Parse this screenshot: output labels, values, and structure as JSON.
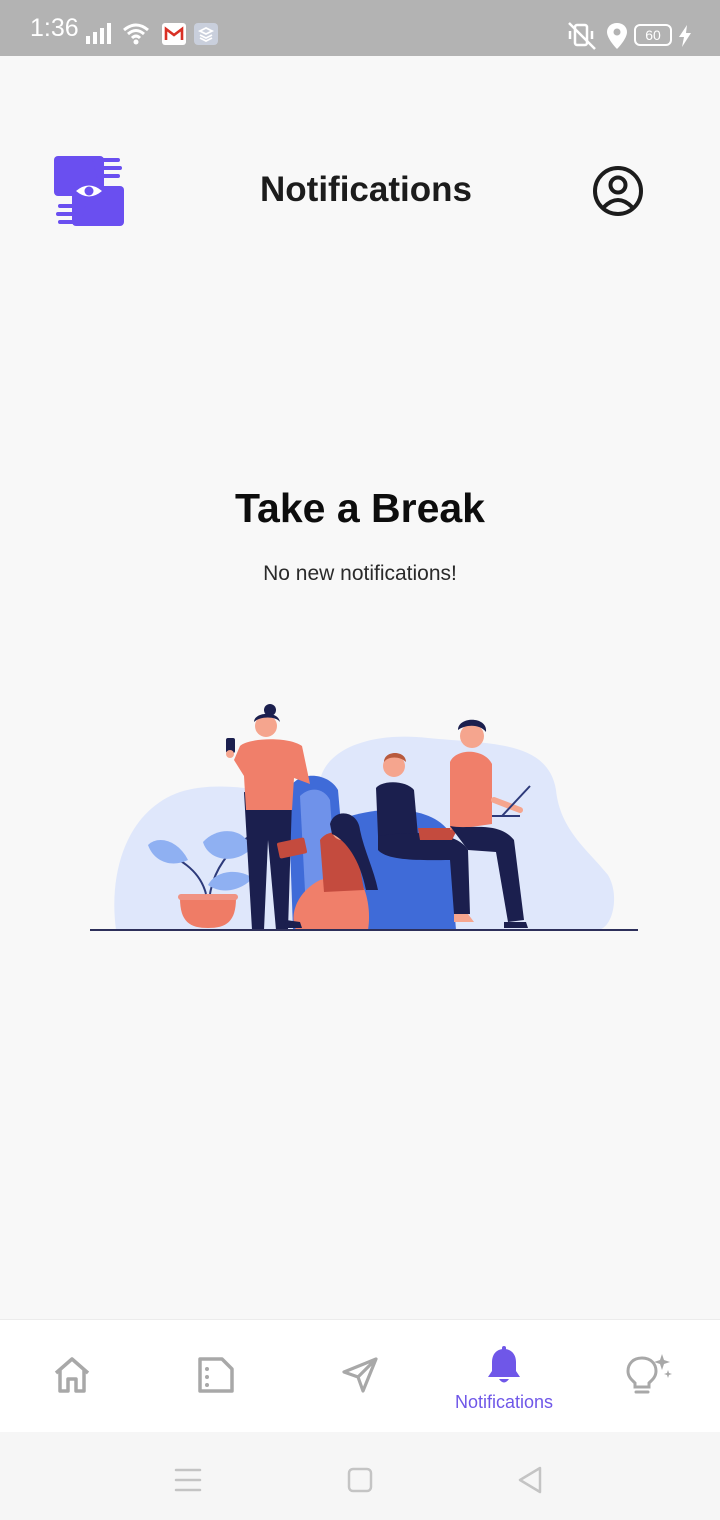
{
  "status_bar": {
    "time": "1:36",
    "battery": "60",
    "icons": [
      "signal-icon",
      "wifi-icon",
      "gmail-icon",
      "app-icon",
      "vibrate-off-icon",
      "location-icon",
      "battery-icon",
      "charging-icon"
    ]
  },
  "header": {
    "title": "Notifications",
    "logo_icon": "app-logo-hands-eye-icon",
    "profile_icon": "user-circle-icon"
  },
  "empty_state": {
    "title": "Take a Break",
    "subtitle": "No new notifications!",
    "illustration": "people-relaxing-illustration"
  },
  "bottom_nav": {
    "active_index": 3,
    "items": [
      {
        "icon": "home-icon",
        "label": ""
      },
      {
        "icon": "document-icon",
        "label": ""
      },
      {
        "icon": "send-icon",
        "label": ""
      },
      {
        "icon": "bell-icon",
        "label": "Notifications"
      },
      {
        "icon": "lightbulb-sparkle-icon",
        "label": ""
      }
    ]
  },
  "system_nav": {
    "icons": [
      "menu-icon",
      "home-square-icon",
      "back-icon"
    ]
  },
  "colors": {
    "accent": "#6f57e8",
    "logo": "#6a4ff0",
    "inactive_icon": "#a8a8a8",
    "status_bar": "#b3b3b3"
  }
}
